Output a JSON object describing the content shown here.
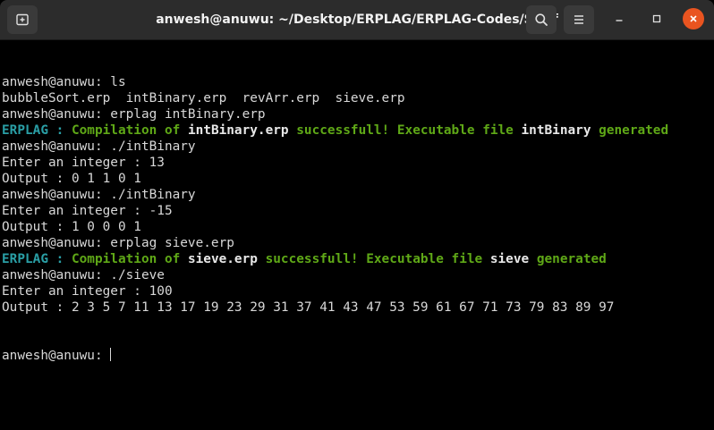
{
  "window": {
    "title": "anwesh@anuwu: ~/Desktop/ERPLAG/ERPLAG-Codes/Stuff"
  },
  "icons": {
    "new_tab": "new-tab-icon",
    "search": "search-icon",
    "menu": "hamburger-menu-icon",
    "minimize": "minimize-icon",
    "maximize": "maximize-icon",
    "close": "close-icon"
  },
  "colors": {
    "close_button": "#e95420",
    "prompt_cyan": "#2a9fa6",
    "success_green": "#5fa817",
    "background": "#000000",
    "titlebar": "#2c2c2c"
  },
  "terminal": {
    "lines": [
      {
        "segments": [
          {
            "text": "anwesh@anuwu: ls",
            "style": "plain"
          }
        ]
      },
      {
        "segments": [
          {
            "text": "bubbleSort.erp  intBinary.erp  revArr.erp  sieve.erp",
            "style": "plain"
          }
        ]
      },
      {
        "segments": [
          {
            "text": "anwesh@anuwu: erplag intBinary.erp",
            "style": "plain"
          }
        ]
      },
      {
        "segments": [
          {
            "text": "ERPLAG : ",
            "style": "cyan"
          },
          {
            "text": "Compilation of ",
            "style": "green"
          },
          {
            "text": "intBinary.erp",
            "style": "white"
          },
          {
            "text": " successfull! Executable file ",
            "style": "green"
          },
          {
            "text": "intBinary",
            "style": "white"
          },
          {
            "text": " generated",
            "style": "green"
          }
        ]
      },
      {
        "segments": [
          {
            "text": "anwesh@anuwu: ./intBinary",
            "style": "plain"
          }
        ]
      },
      {
        "segments": [
          {
            "text": "Enter an integer : 13",
            "style": "plain"
          }
        ]
      },
      {
        "segments": [
          {
            "text": "Output : 0 1 1 0 1",
            "style": "plain"
          }
        ]
      },
      {
        "segments": [
          {
            "text": "anwesh@anuwu: ./intBinary",
            "style": "plain"
          }
        ]
      },
      {
        "segments": [
          {
            "text": "Enter an integer : -15",
            "style": "plain"
          }
        ]
      },
      {
        "segments": [
          {
            "text": "Output : 1 0 0 0 1",
            "style": "plain"
          }
        ]
      },
      {
        "segments": [
          {
            "text": "anwesh@anuwu: erplag sieve.erp",
            "style": "plain"
          }
        ]
      },
      {
        "segments": [
          {
            "text": "ERPLAG : ",
            "style": "cyan"
          },
          {
            "text": "Compilation of ",
            "style": "green"
          },
          {
            "text": "sieve.erp",
            "style": "white"
          },
          {
            "text": " successfull! Executable file ",
            "style": "green"
          },
          {
            "text": "sieve",
            "style": "white"
          },
          {
            "text": " generated",
            "style": "green"
          }
        ]
      },
      {
        "segments": [
          {
            "text": "anwesh@anuwu: ./sieve",
            "style": "plain"
          }
        ]
      },
      {
        "segments": [
          {
            "text": "Enter an integer : 100",
            "style": "plain"
          }
        ]
      },
      {
        "segments": [
          {
            "text": "Output : 2 3 5 7 11 13 17 19 23 29 31 37 41 43 47 53 59 61 67 71 73 79 83 89 97",
            "style": "plain"
          }
        ]
      }
    ],
    "prompt": "anwesh@anuwu: "
  }
}
